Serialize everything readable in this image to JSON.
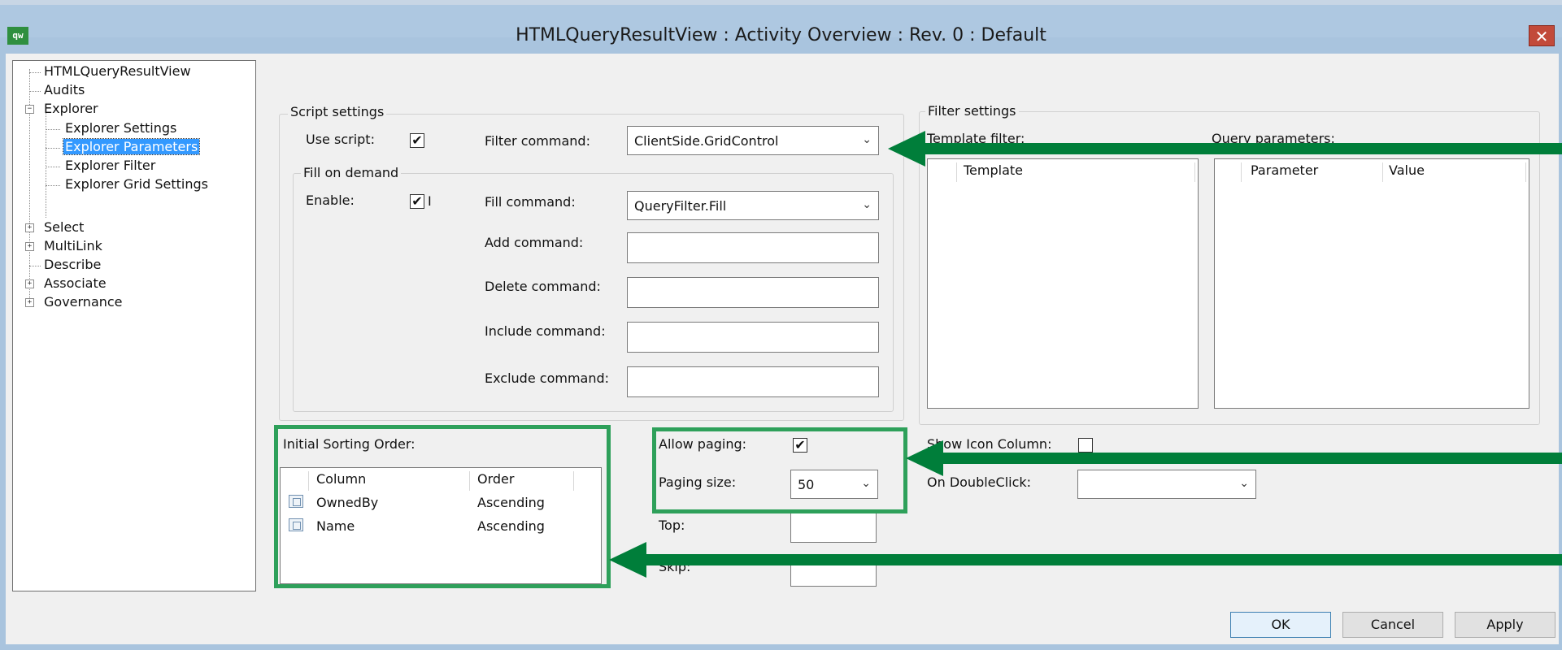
{
  "window": {
    "app_icon": "qw",
    "title": "HTMLQueryResultView : Activity Overview : Rev. 0  : Default",
    "close": "✕"
  },
  "tree": {
    "root": "HTMLQueryResultView",
    "audits": "Audits",
    "explorer": "Explorer",
    "explorer_settings": "Explorer Settings",
    "explorer_parameters": "Explorer Parameters",
    "explorer_filter": "Explorer Filter",
    "explorer_grid_settings": "Explorer Grid Settings",
    "select": "Select",
    "multilink": "MultiLink",
    "describe": "Describe",
    "associate": "Associate",
    "governance": "Governance",
    "expand_symbol": "+",
    "collapse_symbol": "−"
  },
  "script_settings": {
    "legend": "Script settings",
    "use_script_label": "Use script:",
    "use_script_checked": "✔",
    "filter_command_label": "Filter command:",
    "filter_command_value": "ClientSide.GridControl"
  },
  "fill_on_demand": {
    "legend": "Fill on demand",
    "enable_label": "Enable:",
    "enable_checked": "✔",
    "enable_suffix": "I",
    "fill_command_label": "Fill command:",
    "fill_command_value": "QueryFilter.Fill",
    "add_command_label": "Add command:",
    "delete_command_label": "Delete command:",
    "include_command_label": "Include command:",
    "exclude_command_label": "Exclude command:"
  },
  "filter_settings": {
    "legend": "Filter settings",
    "template_filter_label": "Template filter:",
    "template_col": "Template",
    "query_params_label": "Query parameters:",
    "parameter_col": "Parameter",
    "value_col": "Value"
  },
  "sorting": {
    "label": "Initial Sorting Order:",
    "col_column": "Column",
    "col_order": "Order",
    "rows": [
      {
        "column": "OwnedBy",
        "order": "Ascending"
      },
      {
        "column": "Name",
        "order": "Ascending"
      }
    ]
  },
  "paging": {
    "allow_label": "Allow paging:",
    "allow_checked": "✔",
    "size_label": "Paging size:",
    "size_value": "50",
    "top_label": "Top:",
    "skip_label": "Skip:"
  },
  "misc": {
    "show_icon_column_label": "Show Icon Column:",
    "on_doubleclick_label": "On DoubleClick:"
  },
  "buttons": {
    "ok": "OK",
    "cancel": "Cancel",
    "apply": "Apply"
  },
  "combo_arrow": "⌄",
  "colors": {
    "highlight": "#2ea05a",
    "arrow": "#007e3a",
    "title_bar": "#aec8e1",
    "selection": "#3399ff"
  }
}
